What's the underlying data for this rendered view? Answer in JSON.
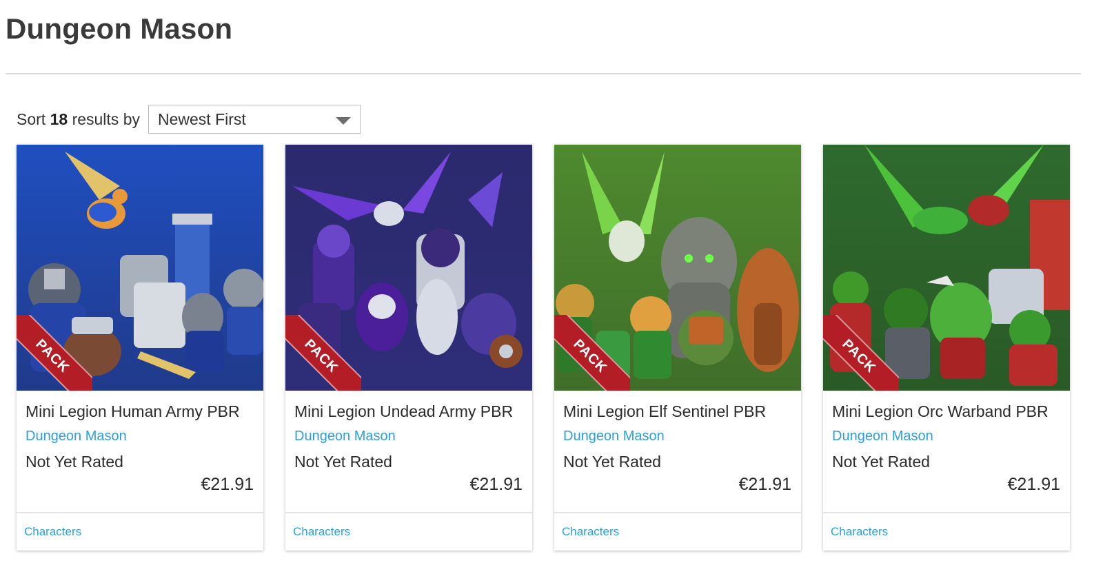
{
  "page": {
    "title": "Dungeon Mason"
  },
  "sort": {
    "prefix": "Sort",
    "count": "18",
    "suffix": "results by",
    "selected": "Newest First"
  },
  "ribbon_label": "PACK",
  "products": [
    {
      "title": "Mini Legion Human Army PBR",
      "publisher": "Dungeon Mason",
      "rating": "Not Yet Rated",
      "price": "€21.91",
      "category": "Characters",
      "thumb_colors": [
        "#1a3f9e",
        "#2d6fd6"
      ]
    },
    {
      "title": "Mini Legion Undead Army PBR",
      "publisher": "Dungeon Mason",
      "rating": "Not Yet Rated",
      "price": "€21.91",
      "category": "Characters",
      "thumb_colors": [
        "#23204f",
        "#5a3ab8"
      ]
    },
    {
      "title": "Mini Legion Elf Sentinel PBR",
      "publisher": "Dungeon Mason",
      "rating": "Not Yet Rated",
      "price": "€21.91",
      "category": "Characters",
      "thumb_colors": [
        "#2e5a1e",
        "#5f9a3a"
      ]
    },
    {
      "title": "Mini Legion Orc Warband PBR",
      "publisher": "Dungeon Mason",
      "rating": "Not Yet Rated",
      "price": "€21.91",
      "category": "Characters",
      "thumb_colors": [
        "#1f4a22",
        "#3f7a3a"
      ]
    }
  ],
  "colors": {
    "link": "#2a9fdc",
    "ribbon": "#b21d26",
    "title": "#3a3a3a"
  }
}
